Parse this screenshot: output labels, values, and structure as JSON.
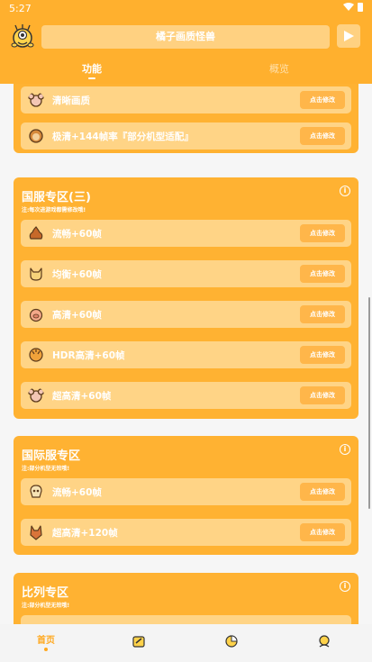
{
  "status": {
    "time": "5:27"
  },
  "header": {
    "title": "橘子画质怪兽"
  },
  "tabs": [
    {
      "label": "功能"
    },
    {
      "label": "概览"
    }
  ],
  "sections": [
    {
      "title": "",
      "note": "",
      "rows": [
        {
          "label": "清晰画质",
          "button": "点击修改"
        },
        {
          "label": "极清+144帧率『部分机型适配』",
          "button": "点击修改"
        }
      ]
    },
    {
      "title": "国服专区(三)",
      "note": "注:每次进游戏都需修改哦!",
      "rows": [
        {
          "label": "流畅+60帧",
          "button": "点击修改"
        },
        {
          "label": "均衡+60帧",
          "button": "点击修改"
        },
        {
          "label": "高清+60帧",
          "button": "点击修改"
        },
        {
          "label": "HDR高清+60帧",
          "button": "点击修改"
        },
        {
          "label": "超高清+60帧",
          "button": "点击修改"
        }
      ]
    },
    {
      "title": "国际服专区",
      "note": "注:部分机型无效哦!",
      "rows": [
        {
          "label": "流畅+60帧",
          "button": "点击修改"
        },
        {
          "label": "超高清+120帧",
          "button": "点击修改"
        }
      ]
    },
    {
      "title": "比列专区",
      "note": "注:部分机型无效哦!",
      "rows": []
    }
  ],
  "bottom_nav": {
    "home_label": "首页"
  },
  "colors": {
    "accent": "#ffb02e",
    "card": "#ffb232",
    "row": "#ffd486",
    "button": "#ffb64a"
  }
}
